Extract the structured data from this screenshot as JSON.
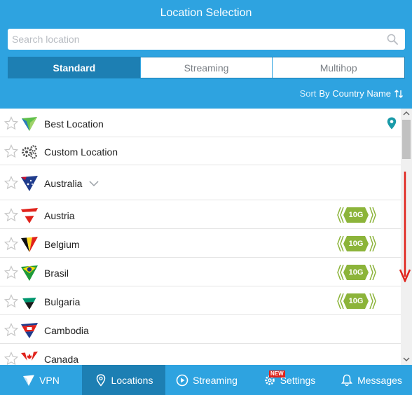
{
  "header": {
    "title": "Location Selection",
    "search_placeholder": "Search location",
    "tabs": [
      {
        "label": "Standard",
        "active": true
      },
      {
        "label": "Streaming",
        "active": false
      },
      {
        "label": "Multihop",
        "active": false
      }
    ],
    "sort": {
      "prefix": "Sort",
      "value": "By Country Name"
    }
  },
  "locations": [
    {
      "name": "Best Location",
      "icon": "best-location-logo",
      "badge": null,
      "pin": true
    },
    {
      "name": "Custom Location",
      "icon": "gears-icon",
      "badge": null
    },
    {
      "name": "Australia",
      "icon": "australia-flag",
      "badge": null,
      "expandable": true
    },
    {
      "name": "Austria",
      "icon": "austria-flag",
      "badge": "10G"
    },
    {
      "name": "Belgium",
      "icon": "belgium-flag",
      "badge": "10G"
    },
    {
      "name": "Brasil",
      "icon": "brasil-flag",
      "badge": "10G"
    },
    {
      "name": "Bulgaria",
      "icon": "bulgaria-flag",
      "badge": "10G"
    },
    {
      "name": "Cambodia",
      "icon": "cambodia-flag",
      "badge": null
    },
    {
      "name": "Canada",
      "icon": "canada-flag",
      "badge": null
    }
  ],
  "bottom_nav": [
    {
      "label": "VPN",
      "icon": "vpn-icon",
      "active": false
    },
    {
      "label": "Locations",
      "icon": "location-pin-icon",
      "active": true
    },
    {
      "label": "Streaming",
      "icon": "play-icon",
      "active": false
    },
    {
      "label": "Settings",
      "icon": "gear-icon",
      "active": false,
      "badge": "NEW"
    },
    {
      "label": "Messages",
      "icon": "bell-icon",
      "active": false
    }
  ],
  "colors": {
    "header_bg": "#2ea3e0",
    "active_tab": "#1d7fb3",
    "badge_green": "#8cb43a",
    "pin_teal": "#1a9aa8",
    "arrow_red": "#e0221b"
  }
}
